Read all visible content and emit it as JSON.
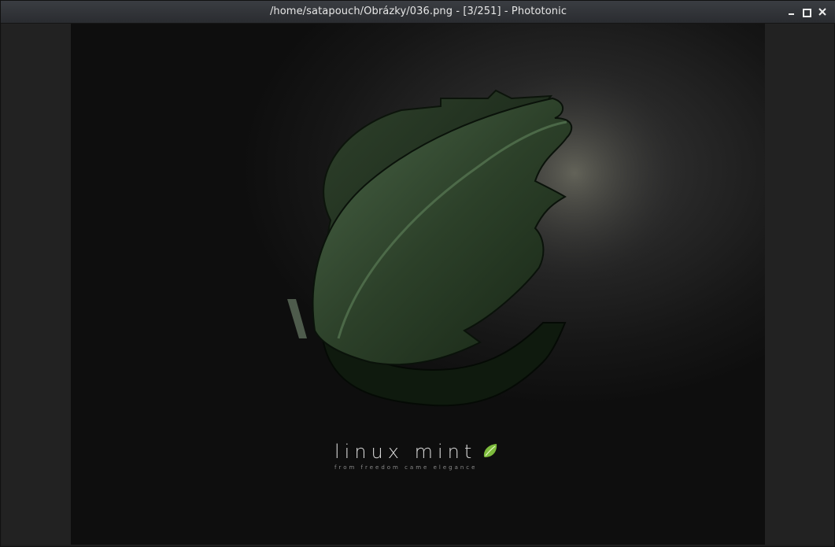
{
  "window": {
    "title": "/home/satapouch/Obrázky/036.png - [3/251] - Phototonic"
  },
  "controls": {
    "minimize_icon": "minimize-icon",
    "maximize_icon": "maximize-icon",
    "close_icon": "close-icon"
  },
  "image": {
    "brand_name": "linux mint",
    "tagline": "from freedom came elegance",
    "accent_color": "#7dbb3c"
  }
}
